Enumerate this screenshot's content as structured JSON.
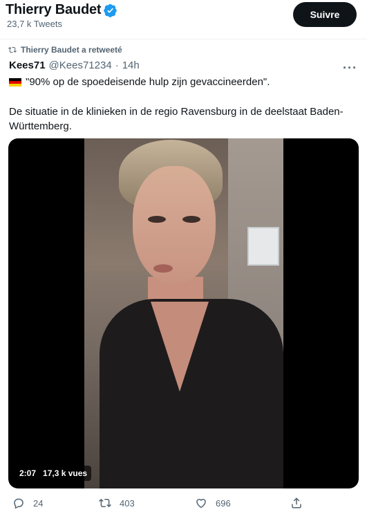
{
  "profile": {
    "name": "Thierry Baudet",
    "tweet_count": "23,7 k Tweets",
    "follow_label": "Suivre"
  },
  "retweet": {
    "label": "Thierry Baudet a retweeté"
  },
  "tweet": {
    "author_name": "Kees71",
    "author_handle": "@Kees71234",
    "separator": "·",
    "time": "14h",
    "more_icon": "more-horizontal-icon",
    "line1": "\"90% op de spoedeisende hulp zijn gevaccineerden\".",
    "line1_flag": "germany-flag",
    "body": "De situatie in de klinieken in de regio Ravensburg in de deelstaat Baden-Württemberg."
  },
  "video": {
    "duration": "2:07",
    "views": "17,3 k vues"
  },
  "actions": {
    "replies": "24",
    "retweets": "403",
    "likes": "696"
  },
  "colors": {
    "accent": "#1d9bf0",
    "text": "#0f1419",
    "muted": "#536471",
    "button_bg": "#0f1419"
  }
}
